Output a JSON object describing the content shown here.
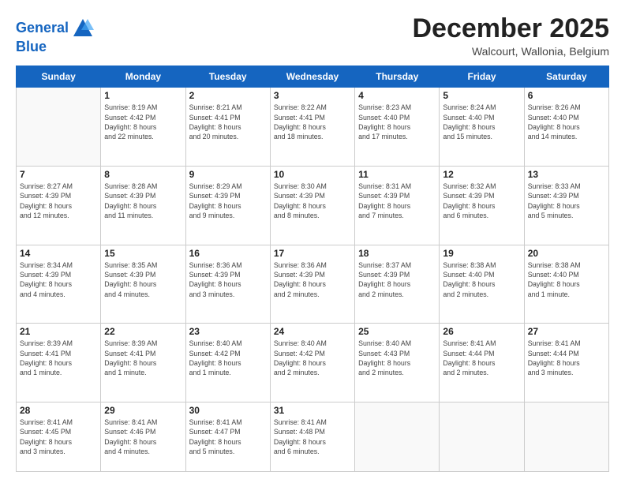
{
  "logo": {
    "line1": "General",
    "line2": "Blue"
  },
  "title": "December 2025",
  "subtitle": "Walcourt, Wallonia, Belgium",
  "days_header": [
    "Sunday",
    "Monday",
    "Tuesday",
    "Wednesday",
    "Thursday",
    "Friday",
    "Saturday"
  ],
  "weeks": [
    [
      {
        "num": "",
        "info": ""
      },
      {
        "num": "1",
        "info": "Sunrise: 8:19 AM\nSunset: 4:42 PM\nDaylight: 8 hours\nand 22 minutes."
      },
      {
        "num": "2",
        "info": "Sunrise: 8:21 AM\nSunset: 4:41 PM\nDaylight: 8 hours\nand 20 minutes."
      },
      {
        "num": "3",
        "info": "Sunrise: 8:22 AM\nSunset: 4:41 PM\nDaylight: 8 hours\nand 18 minutes."
      },
      {
        "num": "4",
        "info": "Sunrise: 8:23 AM\nSunset: 4:40 PM\nDaylight: 8 hours\nand 17 minutes."
      },
      {
        "num": "5",
        "info": "Sunrise: 8:24 AM\nSunset: 4:40 PM\nDaylight: 8 hours\nand 15 minutes."
      },
      {
        "num": "6",
        "info": "Sunrise: 8:26 AM\nSunset: 4:40 PM\nDaylight: 8 hours\nand 14 minutes."
      }
    ],
    [
      {
        "num": "7",
        "info": "Sunrise: 8:27 AM\nSunset: 4:39 PM\nDaylight: 8 hours\nand 12 minutes."
      },
      {
        "num": "8",
        "info": "Sunrise: 8:28 AM\nSunset: 4:39 PM\nDaylight: 8 hours\nand 11 minutes."
      },
      {
        "num": "9",
        "info": "Sunrise: 8:29 AM\nSunset: 4:39 PM\nDaylight: 8 hours\nand 9 minutes."
      },
      {
        "num": "10",
        "info": "Sunrise: 8:30 AM\nSunset: 4:39 PM\nDaylight: 8 hours\nand 8 minutes."
      },
      {
        "num": "11",
        "info": "Sunrise: 8:31 AM\nSunset: 4:39 PM\nDaylight: 8 hours\nand 7 minutes."
      },
      {
        "num": "12",
        "info": "Sunrise: 8:32 AM\nSunset: 4:39 PM\nDaylight: 8 hours\nand 6 minutes."
      },
      {
        "num": "13",
        "info": "Sunrise: 8:33 AM\nSunset: 4:39 PM\nDaylight: 8 hours\nand 5 minutes."
      }
    ],
    [
      {
        "num": "14",
        "info": "Sunrise: 8:34 AM\nSunset: 4:39 PM\nDaylight: 8 hours\nand 4 minutes."
      },
      {
        "num": "15",
        "info": "Sunrise: 8:35 AM\nSunset: 4:39 PM\nDaylight: 8 hours\nand 4 minutes."
      },
      {
        "num": "16",
        "info": "Sunrise: 8:36 AM\nSunset: 4:39 PM\nDaylight: 8 hours\nand 3 minutes."
      },
      {
        "num": "17",
        "info": "Sunrise: 8:36 AM\nSunset: 4:39 PM\nDaylight: 8 hours\nand 2 minutes."
      },
      {
        "num": "18",
        "info": "Sunrise: 8:37 AM\nSunset: 4:39 PM\nDaylight: 8 hours\nand 2 minutes."
      },
      {
        "num": "19",
        "info": "Sunrise: 8:38 AM\nSunset: 4:40 PM\nDaylight: 8 hours\nand 2 minutes."
      },
      {
        "num": "20",
        "info": "Sunrise: 8:38 AM\nSunset: 4:40 PM\nDaylight: 8 hours\nand 1 minute."
      }
    ],
    [
      {
        "num": "21",
        "info": "Sunrise: 8:39 AM\nSunset: 4:41 PM\nDaylight: 8 hours\nand 1 minute."
      },
      {
        "num": "22",
        "info": "Sunrise: 8:39 AM\nSunset: 4:41 PM\nDaylight: 8 hours\nand 1 minute."
      },
      {
        "num": "23",
        "info": "Sunrise: 8:40 AM\nSunset: 4:42 PM\nDaylight: 8 hours\nand 1 minute."
      },
      {
        "num": "24",
        "info": "Sunrise: 8:40 AM\nSunset: 4:42 PM\nDaylight: 8 hours\nand 2 minutes."
      },
      {
        "num": "25",
        "info": "Sunrise: 8:40 AM\nSunset: 4:43 PM\nDaylight: 8 hours\nand 2 minutes."
      },
      {
        "num": "26",
        "info": "Sunrise: 8:41 AM\nSunset: 4:44 PM\nDaylight: 8 hours\nand 2 minutes."
      },
      {
        "num": "27",
        "info": "Sunrise: 8:41 AM\nSunset: 4:44 PM\nDaylight: 8 hours\nand 3 minutes."
      }
    ],
    [
      {
        "num": "28",
        "info": "Sunrise: 8:41 AM\nSunset: 4:45 PM\nDaylight: 8 hours\nand 3 minutes."
      },
      {
        "num": "29",
        "info": "Sunrise: 8:41 AM\nSunset: 4:46 PM\nDaylight: 8 hours\nand 4 minutes."
      },
      {
        "num": "30",
        "info": "Sunrise: 8:41 AM\nSunset: 4:47 PM\nDaylight: 8 hours\nand 5 minutes."
      },
      {
        "num": "31",
        "info": "Sunrise: 8:41 AM\nSunset: 4:48 PM\nDaylight: 8 hours\nand 6 minutes."
      },
      {
        "num": "",
        "info": ""
      },
      {
        "num": "",
        "info": ""
      },
      {
        "num": "",
        "info": ""
      }
    ]
  ]
}
